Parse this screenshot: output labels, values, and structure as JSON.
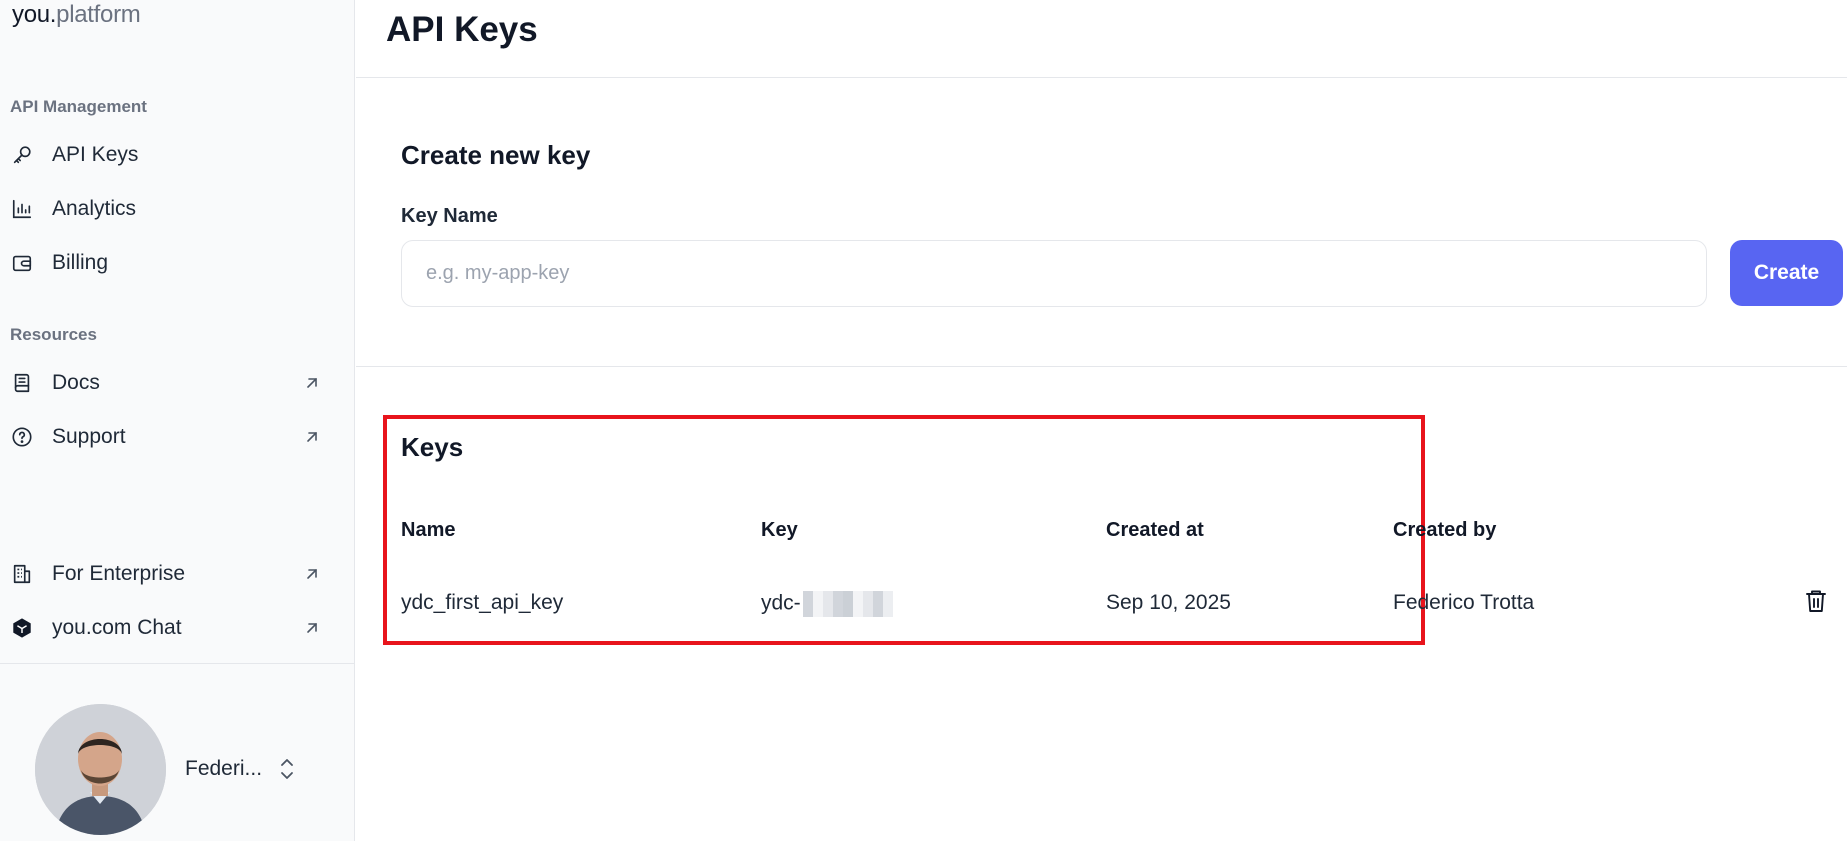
{
  "brand": {
    "part1": "you.",
    "part2": "platform"
  },
  "sidebar": {
    "section_api": "API Management",
    "section_resources": "Resources",
    "items": [
      {
        "label": "API Keys",
        "icon": "key-icon"
      },
      {
        "label": "Analytics",
        "icon": "bar-chart-icon"
      },
      {
        "label": "Billing",
        "icon": "wallet-icon"
      },
      {
        "label": "Docs",
        "icon": "document-icon"
      },
      {
        "label": "Support",
        "icon": "help-circle-icon"
      },
      {
        "label": "For Enterprise",
        "icon": "building-icon"
      },
      {
        "label": "you.com Chat",
        "icon": "you-logo-icon"
      }
    ],
    "user": {
      "name": "Federi..."
    }
  },
  "page": {
    "title": "API Keys"
  },
  "create": {
    "title": "Create new key",
    "label": "Key Name",
    "placeholder": "e.g. my-app-key",
    "button": "Create"
  },
  "keys": {
    "title": "Keys",
    "columns": [
      "Name",
      "Key",
      "Created at",
      "Created by"
    ],
    "rows": [
      {
        "name": "ydc_first_api_key",
        "key": "ydc-",
        "created_at": "Sep 10, 2025",
        "created_by": "Federico Trotta"
      }
    ]
  },
  "colors": {
    "accent": "#5865f2",
    "highlight": "#e8141c"
  }
}
